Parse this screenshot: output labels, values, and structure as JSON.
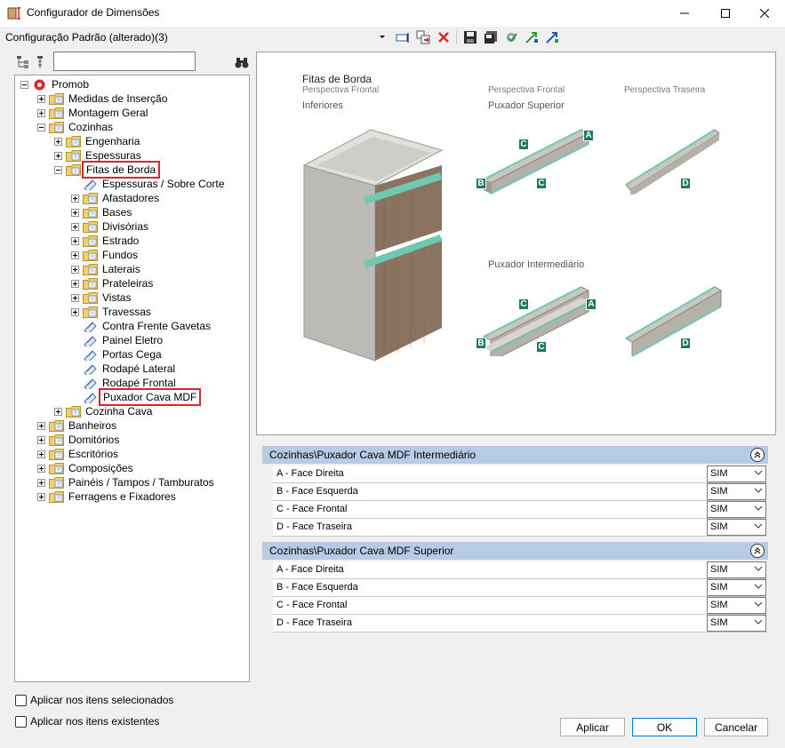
{
  "window": {
    "title": "Configurador de Dimensões",
    "minimize_icon": "minimize-icon",
    "maximize_icon": "maximize-icon",
    "close_icon": "close-icon"
  },
  "config": {
    "label": "Configuração Padrão (alterado)(3)"
  },
  "tree": {
    "items": [
      {
        "label": "Promob",
        "level": 0,
        "expanded": true,
        "icon": "promob-logo-icon"
      },
      {
        "label": "Medidas de Inserção",
        "level": 1,
        "expanded": false
      },
      {
        "label": "Montagem Geral",
        "level": 1,
        "expanded": false
      },
      {
        "label": "Cozinhas",
        "level": 1,
        "expanded": true
      },
      {
        "label": "Engenharia",
        "level": 2,
        "expanded": false
      },
      {
        "label": "Espessuras",
        "level": 2,
        "expanded": false
      },
      {
        "label": "Fitas de Borda",
        "level": 2,
        "expanded": true,
        "highlight": true
      },
      {
        "label": "Espessuras / Sobre Corte",
        "level": 3,
        "leaf": true
      },
      {
        "label": "Afastadores",
        "level": 3,
        "expanded": false
      },
      {
        "label": "Bases",
        "level": 3,
        "expanded": false
      },
      {
        "label": "Divisórias",
        "level": 3,
        "expanded": false
      },
      {
        "label": "Estrado",
        "level": 3,
        "expanded": false
      },
      {
        "label": "Fundos",
        "level": 3,
        "expanded": false
      },
      {
        "label": "Laterais",
        "level": 3,
        "expanded": false
      },
      {
        "label": "Prateleiras",
        "level": 3,
        "expanded": false
      },
      {
        "label": "Vistas",
        "level": 3,
        "expanded": false
      },
      {
        "label": "Travessas",
        "level": 3,
        "expanded": false
      },
      {
        "label": "Contra Frente Gavetas",
        "level": 3,
        "leaf": true
      },
      {
        "label": "Painel Eletro",
        "level": 3,
        "leaf": true
      },
      {
        "label": "Portas Cega",
        "level": 3,
        "leaf": true
      },
      {
        "label": "Rodapé Lateral",
        "level": 3,
        "leaf": true
      },
      {
        "label": "Rodapé Frontal",
        "level": 3,
        "leaf": true
      },
      {
        "label": "Puxador Cava MDF",
        "level": 3,
        "leaf": true,
        "highlight": true
      },
      {
        "label": "Cozinha Cava",
        "level": 2,
        "expanded": false
      },
      {
        "label": "Banheiros",
        "level": 1,
        "expanded": false
      },
      {
        "label": "Domitórios",
        "level": 1,
        "expanded": false
      },
      {
        "label": "Escritórios",
        "level": 1,
        "expanded": false
      },
      {
        "label": "Composições",
        "level": 1,
        "expanded": false
      },
      {
        "label": "Painéis / Tampos / Tamburatos",
        "level": 1,
        "expanded": false
      },
      {
        "label": "Ferragens e Fixadores",
        "level": 1,
        "expanded": false
      }
    ]
  },
  "image": {
    "title": "Fitas de Borda",
    "subtitle1": "Perspectiva Frontal",
    "subtitle2": "Inferiores",
    "persp_front": "Perspectiva Frontal",
    "persp_back": "Perspectiva Traseira",
    "puxador_superior": "Puxador Superior",
    "puxador_intermediario": "Puxador Intermediário",
    "tags": {
      "a": "A",
      "b": "B",
      "c": "C",
      "d": "D"
    },
    "accent": "#1e7a5f",
    "edge_color": "#6ec9b0"
  },
  "sections": [
    {
      "title": "Cozinhas\\Puxador Cava MDF Intermediário",
      "rows": [
        {
          "name": "A - Face Direita",
          "value": "SIM"
        },
        {
          "name": "B - Face Esquerda",
          "value": "SIM"
        },
        {
          "name": "C - Face Frontal",
          "value": "SIM"
        },
        {
          "name": "D - Face Traseira",
          "value": "SIM"
        }
      ]
    },
    {
      "title": "Cozinhas\\Puxador Cava MDF Superior",
      "rows": [
        {
          "name": "A - Face Direita",
          "value": "SIM"
        },
        {
          "name": "B - Face Esquerda",
          "value": "SIM"
        },
        {
          "name": "C - Face Frontal",
          "value": "SIM"
        },
        {
          "name": "D - Face Traseira",
          "value": "SIM"
        }
      ]
    }
  ],
  "options": {
    "apply_selected": "Aplicar nos itens selecionados",
    "apply_existing": "Aplicar nos itens existentes"
  },
  "buttons": {
    "apply": "Aplicar",
    "ok": "OK",
    "cancel": "Cancelar"
  }
}
